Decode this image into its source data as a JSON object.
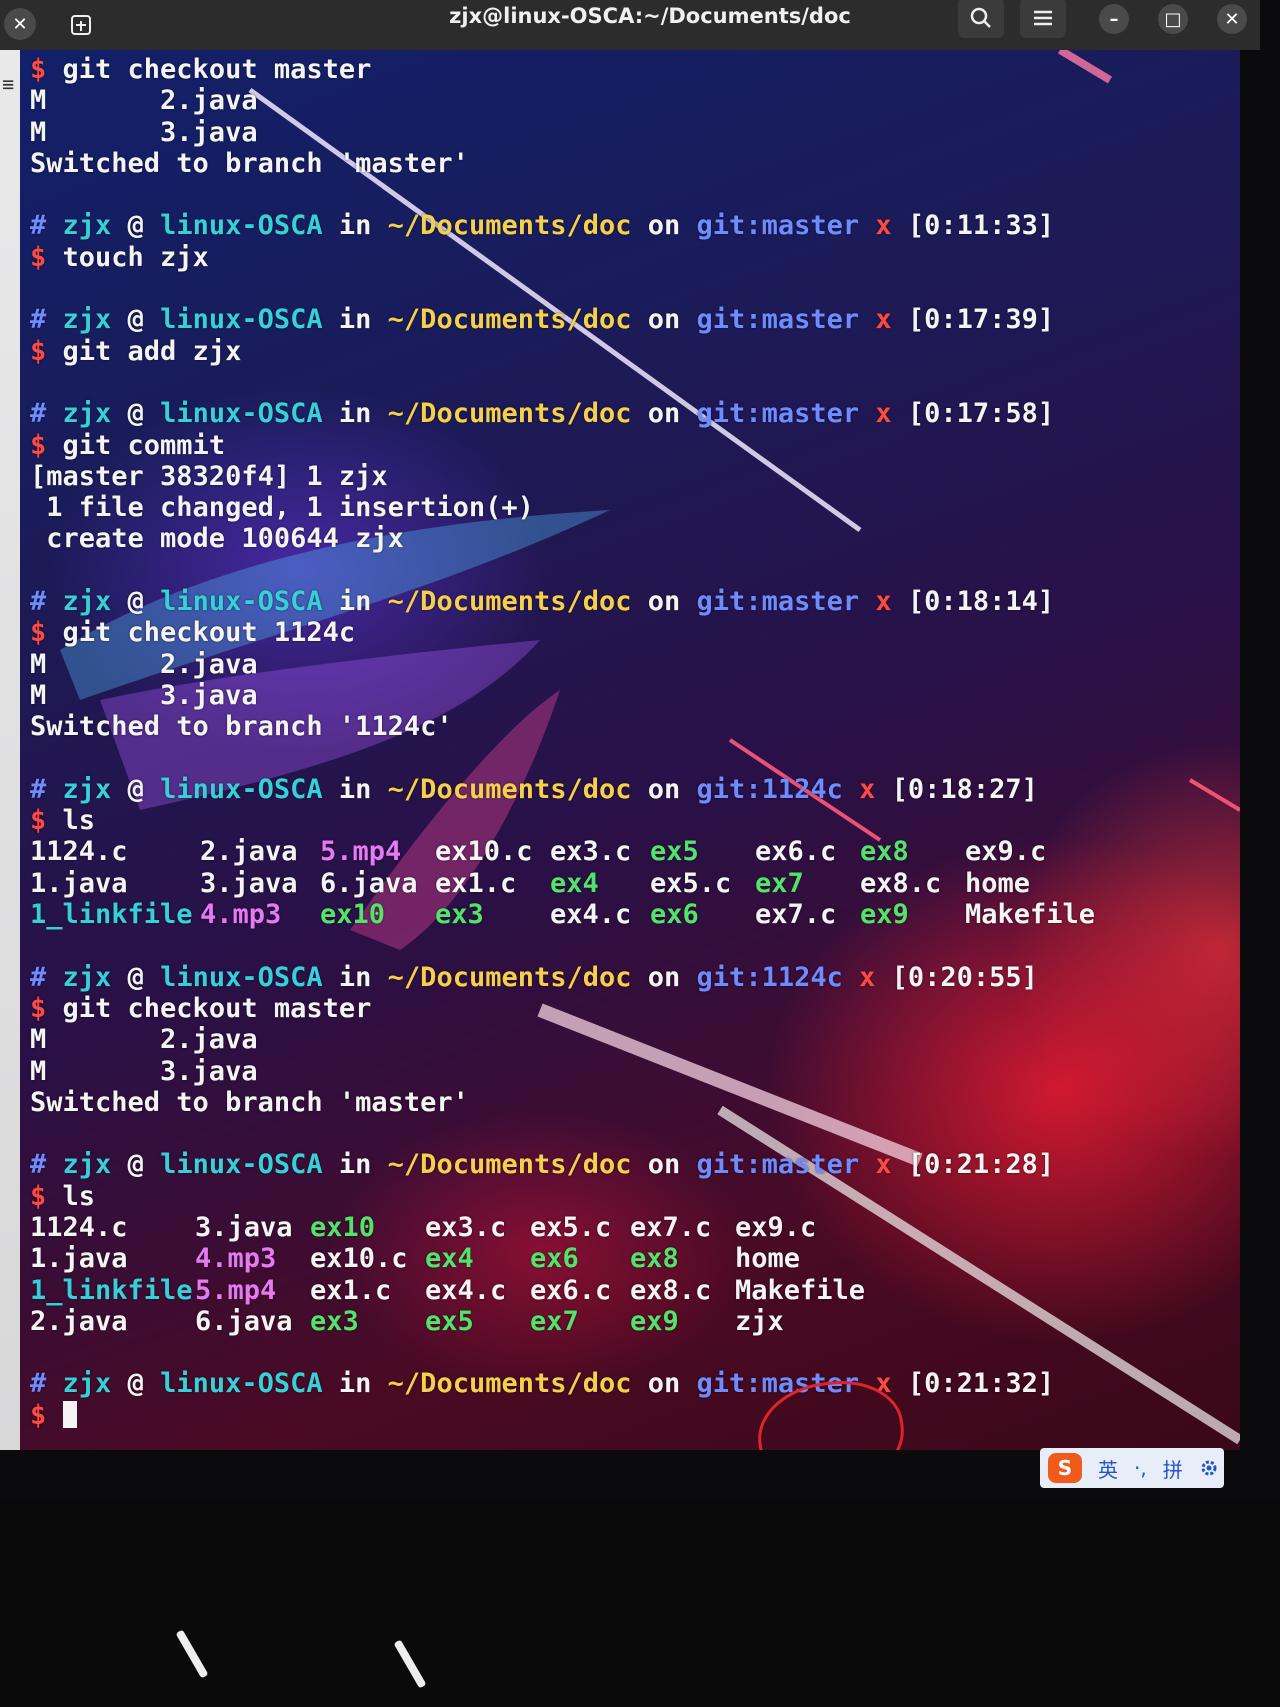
{
  "window": {
    "title": "zjx@linux-OSCA:~/Documents/doc",
    "close_left": "✕",
    "new_tab_icon": "new-tab-icon",
    "search_icon": "search-icon",
    "menu_icon": "hamburger-menu-icon",
    "minimize": "–",
    "maximize": "□",
    "close": "✕"
  },
  "terminal": {
    "lines": [
      [
        {
          "t": "$ ",
          "c": "red"
        },
        {
          "t": "git checkout master",
          "c": "white"
        }
      ],
      [
        {
          "t": "M       2.java",
          "c": "white"
        }
      ],
      [
        {
          "t": "M       3.java",
          "c": "white"
        }
      ],
      [
        {
          "t": "Switched to branch 'master'",
          "c": "white"
        }
      ],
      [
        {
          "t": "",
          "c": "white"
        }
      ],
      [
        {
          "t": "# ",
          "c": "blue"
        },
        {
          "t": "zjx",
          "c": "cyan"
        },
        {
          "t": " @ ",
          "c": "white"
        },
        {
          "t": "linux-OSCA",
          "c": "cyan"
        },
        {
          "t": " in ",
          "c": "white"
        },
        {
          "t": "~/Documents/doc",
          "c": "yellow"
        },
        {
          "t": " on ",
          "c": "white"
        },
        {
          "t": "git:master",
          "c": "blue"
        },
        {
          "t": " x ",
          "c": "red"
        },
        {
          "t": "[0:11:33]",
          "c": "white"
        }
      ],
      [
        {
          "t": "$ ",
          "c": "red"
        },
        {
          "t": "touch zjx",
          "c": "white"
        }
      ],
      [
        {
          "t": "",
          "c": "white"
        }
      ],
      [
        {
          "t": "# ",
          "c": "blue"
        },
        {
          "t": "zjx",
          "c": "cyan"
        },
        {
          "t": " @ ",
          "c": "white"
        },
        {
          "t": "linux-OSCA",
          "c": "cyan"
        },
        {
          "t": " in ",
          "c": "white"
        },
        {
          "t": "~/Documents/doc",
          "c": "yellow"
        },
        {
          "t": " on ",
          "c": "white"
        },
        {
          "t": "git:master",
          "c": "blue"
        },
        {
          "t": " x ",
          "c": "red"
        },
        {
          "t": "[0:17:39]",
          "c": "white"
        }
      ],
      [
        {
          "t": "$ ",
          "c": "red"
        },
        {
          "t": "git add zjx",
          "c": "white"
        }
      ],
      [
        {
          "t": "",
          "c": "white"
        }
      ],
      [
        {
          "t": "# ",
          "c": "blue"
        },
        {
          "t": "zjx",
          "c": "cyan"
        },
        {
          "t": " @ ",
          "c": "white"
        },
        {
          "t": "linux-OSCA",
          "c": "cyan"
        },
        {
          "t": " in ",
          "c": "white"
        },
        {
          "t": "~/Documents/doc",
          "c": "yellow"
        },
        {
          "t": " on ",
          "c": "white"
        },
        {
          "t": "git:master",
          "c": "blue"
        },
        {
          "t": " x ",
          "c": "red"
        },
        {
          "t": "[0:17:58]",
          "c": "white"
        }
      ],
      [
        {
          "t": "$ ",
          "c": "red"
        },
        {
          "t": "git commit",
          "c": "white"
        }
      ],
      [
        {
          "t": "[master 38320f4] 1 zjx",
          "c": "white"
        }
      ],
      [
        {
          "t": " 1 file changed, 1 insertion(+)",
          "c": "white"
        }
      ],
      [
        {
          "t": " create mode 100644 zjx",
          "c": "white"
        }
      ],
      [
        {
          "t": "",
          "c": "white"
        }
      ],
      [
        {
          "t": "# ",
          "c": "blue"
        },
        {
          "t": "zjx",
          "c": "cyan"
        },
        {
          "t": " @ ",
          "c": "white"
        },
        {
          "t": "linux-OSCA",
          "c": "cyan"
        },
        {
          "t": " in ",
          "c": "white"
        },
        {
          "t": "~/Documents/doc",
          "c": "yellow"
        },
        {
          "t": " on ",
          "c": "white"
        },
        {
          "t": "git:master",
          "c": "blue"
        },
        {
          "t": " x ",
          "c": "red"
        },
        {
          "t": "[0:18:14]",
          "c": "white"
        }
      ],
      [
        {
          "t": "$ ",
          "c": "red"
        },
        {
          "t": "git checkout 1124c",
          "c": "white"
        }
      ],
      [
        {
          "t": "M       2.java",
          "c": "white"
        }
      ],
      [
        {
          "t": "M       3.java",
          "c": "white"
        }
      ],
      [
        {
          "t": "Switched to branch '1124c'",
          "c": "white"
        }
      ],
      [
        {
          "t": "",
          "c": "white"
        }
      ],
      [
        {
          "t": "# ",
          "c": "blue"
        },
        {
          "t": "zjx",
          "c": "cyan"
        },
        {
          "t": " @ ",
          "c": "white"
        },
        {
          "t": "linux-OSCA",
          "c": "cyan"
        },
        {
          "t": " in ",
          "c": "white"
        },
        {
          "t": "~/Documents/doc",
          "c": "yellow"
        },
        {
          "t": " on ",
          "c": "white"
        },
        {
          "t": "git:1124c",
          "c": "blue"
        },
        {
          "t": " x ",
          "c": "red"
        },
        {
          "t": "[0:18:27]",
          "c": "white"
        }
      ],
      [
        {
          "t": "$ ",
          "c": "red"
        },
        {
          "t": "ls",
          "c": "white"
        }
      ]
    ],
    "ls1": [
      [
        {
          "t": "1124.c",
          "c": "white"
        },
        {
          "t": "2.java",
          "c": "white"
        },
        {
          "t": "5.mp4",
          "c": "magenta"
        },
        {
          "t": "ex10.c",
          "c": "white"
        },
        {
          "t": "ex3.c",
          "c": "white"
        },
        {
          "t": "ex5",
          "c": "green"
        },
        {
          "t": "ex6.c",
          "c": "white"
        },
        {
          "t": "ex8",
          "c": "green"
        },
        {
          "t": "ex9.c",
          "c": "white"
        }
      ],
      [
        {
          "t": "1.java",
          "c": "white"
        },
        {
          "t": "3.java",
          "c": "white"
        },
        {
          "t": "6.java",
          "c": "white"
        },
        {
          "t": "ex1.c",
          "c": "white"
        },
        {
          "t": "ex4",
          "c": "green"
        },
        {
          "t": "ex5.c",
          "c": "white"
        },
        {
          "t": "ex7",
          "c": "green"
        },
        {
          "t": "ex8.c",
          "c": "white"
        },
        {
          "t": "home",
          "c": "white"
        }
      ],
      [
        {
          "t": "1_linkfile",
          "c": "cyan"
        },
        {
          "t": "4.mp3",
          "c": "magenta"
        },
        {
          "t": "ex10",
          "c": "green"
        },
        {
          "t": "ex3",
          "c": "green"
        },
        {
          "t": "",
          "c": "white"
        },
        {
          "t": "ex4.c",
          "c": "white"
        },
        {
          "t": "ex6",
          "c": "green"
        },
        {
          "t": "ex7.c",
          "c": "white"
        },
        {
          "t": "ex9",
          "c": "green"
        },
        {
          "t": "Makefile",
          "c": "white"
        }
      ]
    ],
    "lines2": [
      [
        {
          "t": "",
          "c": "white"
        }
      ],
      [
        {
          "t": "# ",
          "c": "blue"
        },
        {
          "t": "zjx",
          "c": "cyan"
        },
        {
          "t": " @ ",
          "c": "white"
        },
        {
          "t": "linux-OSCA",
          "c": "cyan"
        },
        {
          "t": " in ",
          "c": "white"
        },
        {
          "t": "~/Documents/doc",
          "c": "yellow"
        },
        {
          "t": " on ",
          "c": "white"
        },
        {
          "t": "git:1124c",
          "c": "blue"
        },
        {
          "t": " x ",
          "c": "red"
        },
        {
          "t": "[0:20:55]",
          "c": "white"
        }
      ],
      [
        {
          "t": "$ ",
          "c": "red"
        },
        {
          "t": "git checkout master",
          "c": "white"
        }
      ],
      [
        {
          "t": "M       2.java",
          "c": "white"
        }
      ],
      [
        {
          "t": "M       3.java",
          "c": "white"
        }
      ],
      [
        {
          "t": "Switched to branch 'master'",
          "c": "white"
        }
      ],
      [
        {
          "t": "",
          "c": "white"
        }
      ],
      [
        {
          "t": "# ",
          "c": "blue"
        },
        {
          "t": "zjx",
          "c": "cyan"
        },
        {
          "t": " @ ",
          "c": "white"
        },
        {
          "t": "linux-OSCA",
          "c": "cyan"
        },
        {
          "t": " in ",
          "c": "white"
        },
        {
          "t": "~/Documents/doc",
          "c": "yellow"
        },
        {
          "t": " on ",
          "c": "white"
        },
        {
          "t": "git:master",
          "c": "blue"
        },
        {
          "t": " x ",
          "c": "red"
        },
        {
          "t": "[0:21:28]",
          "c": "white"
        }
      ],
      [
        {
          "t": "$ ",
          "c": "red"
        },
        {
          "t": "ls",
          "c": "white"
        }
      ]
    ],
    "ls2": [
      [
        {
          "t": "1124.c",
          "c": "white"
        },
        {
          "t": "3.java",
          "c": "white"
        },
        {
          "t": "ex10",
          "c": "green"
        },
        {
          "t": "ex3.c",
          "c": "white"
        },
        {
          "t": "ex5.c",
          "c": "white"
        },
        {
          "t": "ex7.c",
          "c": "white"
        },
        {
          "t": "ex9.c",
          "c": "white"
        }
      ],
      [
        {
          "t": "1.java",
          "c": "white"
        },
        {
          "t": "4.mp3",
          "c": "magenta"
        },
        {
          "t": "ex10.c",
          "c": "white"
        },
        {
          "t": "ex4",
          "c": "green"
        },
        {
          "t": "ex6",
          "c": "green"
        },
        {
          "t": "ex8",
          "c": "green"
        },
        {
          "t": "home",
          "c": "white"
        }
      ],
      [
        {
          "t": "1_linkfile",
          "c": "cyan"
        },
        {
          "t": "5.mp4",
          "c": "magenta"
        },
        {
          "t": "ex1.c",
          "c": "white"
        },
        {
          "t": "ex4.c",
          "c": "white"
        },
        {
          "t": "ex6.c",
          "c": "white"
        },
        {
          "t": "ex8.c",
          "c": "white"
        },
        {
          "t": "Makefile",
          "c": "white"
        }
      ],
      [
        {
          "t": "2.java",
          "c": "white"
        },
        {
          "t": "6.java",
          "c": "white"
        },
        {
          "t": "ex3",
          "c": "green"
        },
        {
          "t": "ex5",
          "c": "green"
        },
        {
          "t": "ex7",
          "c": "green"
        },
        {
          "t": "ex9",
          "c": "green"
        },
        {
          "t": "zjx",
          "c": "white"
        }
      ]
    ],
    "lines3": [
      [
        {
          "t": "",
          "c": "white"
        }
      ],
      [
        {
          "t": "# ",
          "c": "blue"
        },
        {
          "t": "zjx",
          "c": "cyan"
        },
        {
          "t": " @ ",
          "c": "white"
        },
        {
          "t": "linux-OSCA",
          "c": "cyan"
        },
        {
          "t": " in ",
          "c": "white"
        },
        {
          "t": "~/Documents/doc",
          "c": "yellow"
        },
        {
          "t": " on ",
          "c": "white"
        },
        {
          "t": "git:master",
          "c": "blue"
        },
        {
          "t": " x ",
          "c": "red"
        },
        {
          "t": "[0:21:32]",
          "c": "white"
        }
      ],
      [
        {
          "t": "$ ",
          "c": "red"
        }
      ]
    ]
  },
  "ime": {
    "logo": "S",
    "mode_label": "英",
    "punct_label": "·,",
    "pinyin_label": "拼",
    "settings_icon": "gear-icon"
  },
  "colors": {
    "red": "#ff4a44",
    "cyan": "#36d1d8",
    "yellow": "#f5d04a",
    "blue": "#6f8cff",
    "white": "#f4f4f4",
    "green": "#52e36a",
    "magenta": "#e879f5"
  }
}
